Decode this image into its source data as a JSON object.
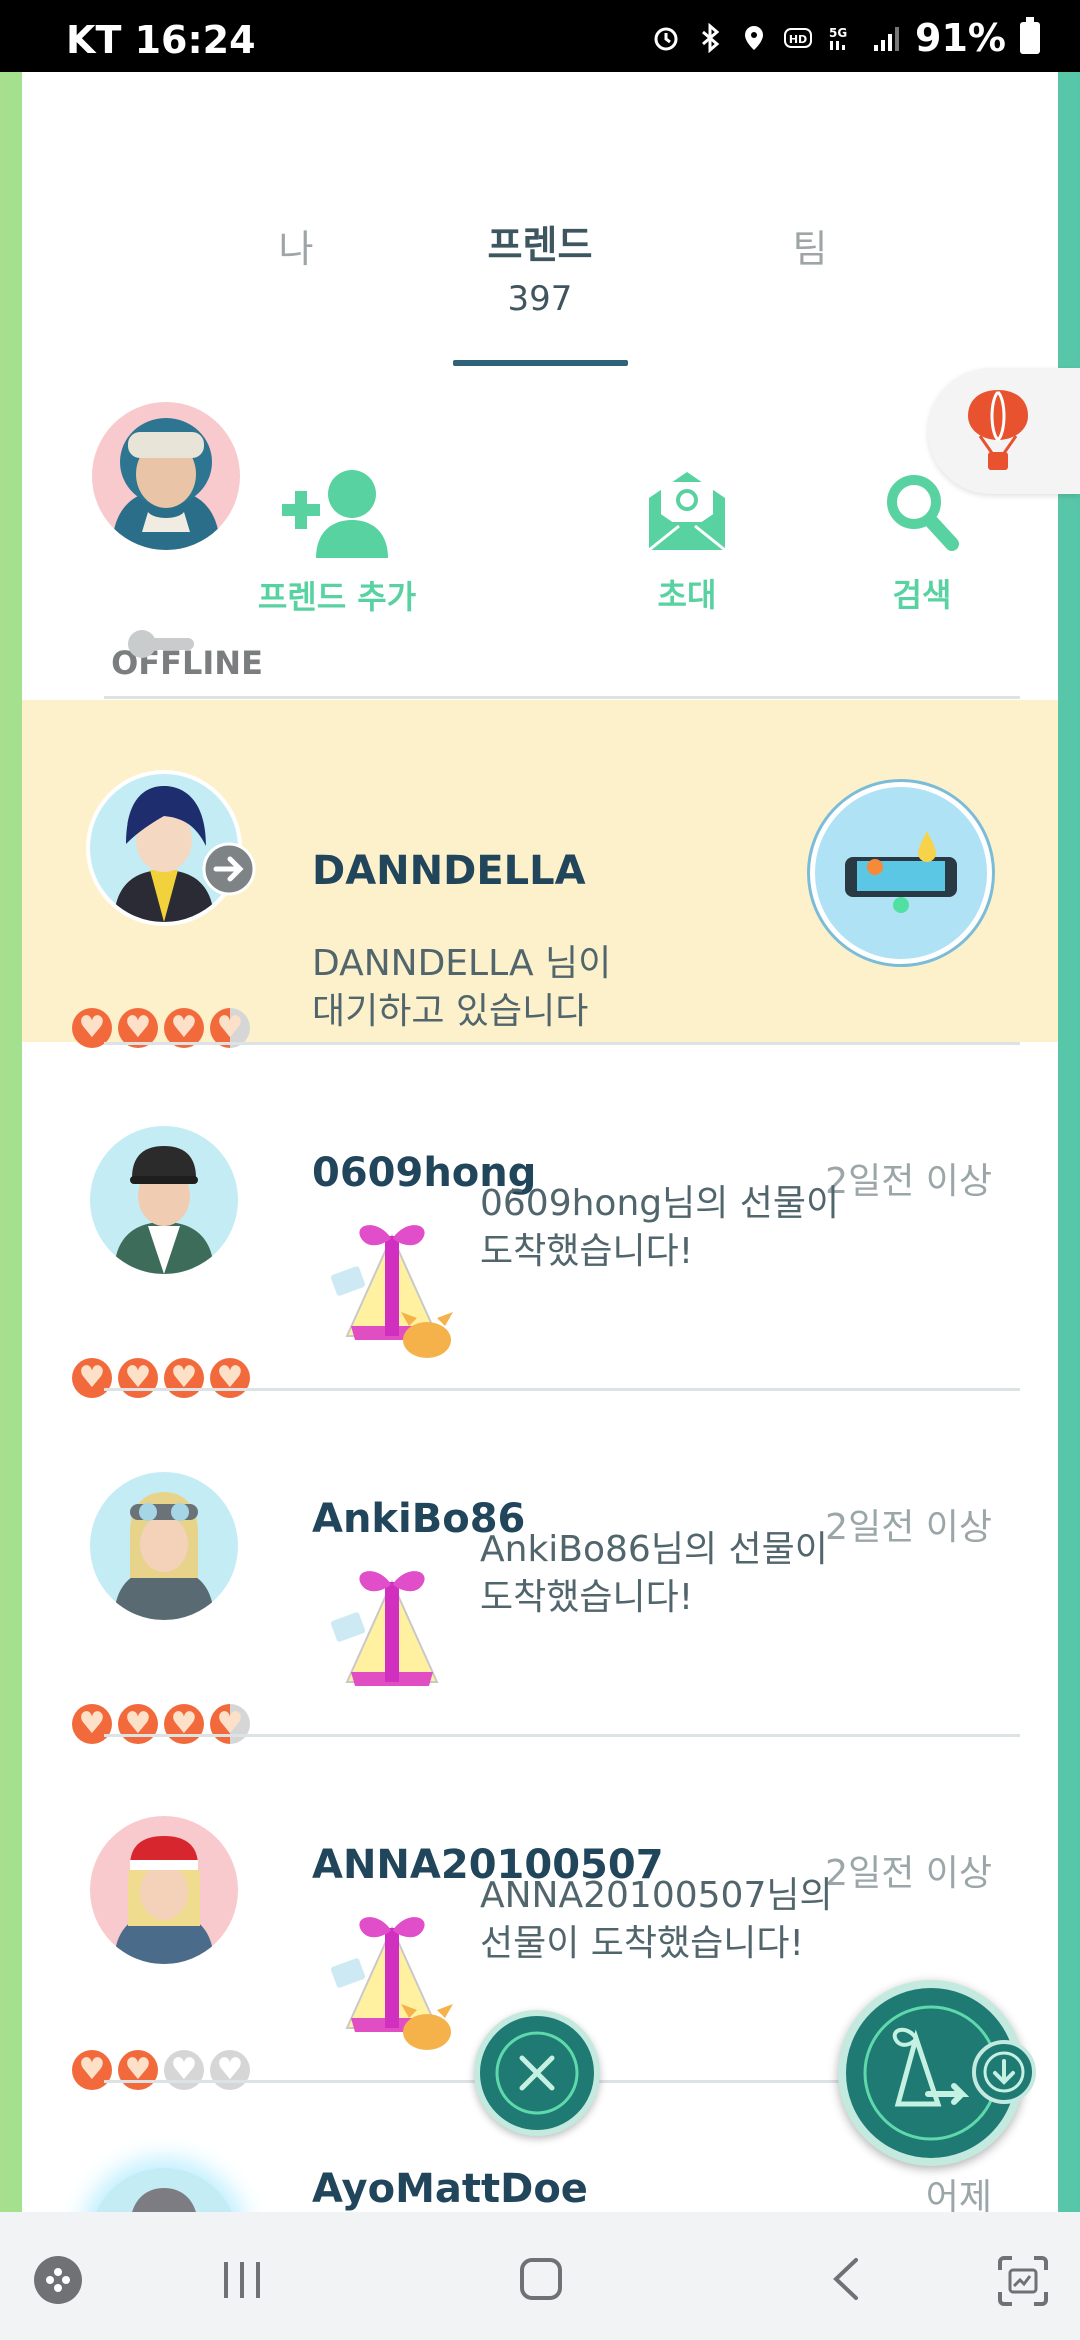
{
  "status_bar": {
    "carrier_time": "KT 16:24",
    "battery": "91%"
  },
  "tabs": [
    {
      "label": "나"
    },
    {
      "label": "프렌드",
      "count": "397"
    },
    {
      "label": "팀"
    }
  ],
  "profile": {
    "status": "OFFLINE"
  },
  "actions": {
    "add_friend": "프렌드 추가",
    "invite": "초대",
    "search": "검색"
  },
  "friends": [
    {
      "name": "DANNDELLA",
      "message": "DANNDELLA 님이\n대기하고 있습니다",
      "hearts": [
        1,
        1,
        1,
        0.5
      ]
    },
    {
      "name": "0609hong",
      "time": "2일전 이상",
      "message": "0609hong님의  선물이\n도착했습니다!",
      "hearts": [
        1,
        1,
        1,
        1
      ]
    },
    {
      "name": "AnkiBo86",
      "time": "2일전 이상",
      "message": "AnkiBo86님의  선물이\n도착했습니다!",
      "hearts": [
        1,
        1,
        1,
        0.5
      ]
    },
    {
      "name": "ANNA20100507",
      "time": "2일전 이상",
      "message": "ANNA20100507님의\n선물이 도착했습니다!",
      "hearts": [
        1,
        1,
        0,
        0
      ]
    },
    {
      "name": "AyoMattDoe",
      "time": "어제"
    }
  ],
  "colors": {
    "accent": "#58d2a1",
    "heart": "#f26a3c",
    "highlight": "#fdf1cc",
    "fab": "#1e7a73"
  }
}
